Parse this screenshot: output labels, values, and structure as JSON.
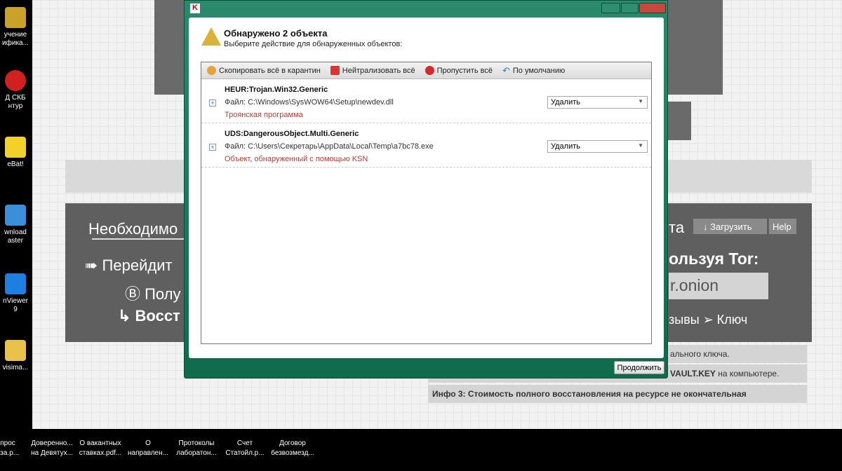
{
  "desktop": {
    "icons": [
      "учение\nифика...",
      "Д СКБ\nнтур",
      "eBat!",
      "wnload\naster",
      "nViewer\n9",
      "visima...",
      "прос\nаза.р..."
    ]
  },
  "taskbar": {
    "items": [
      "Доверенно...\nна Девятух...",
      "О вакантных\nставках.pdf...",
      "О\nнаправлен...",
      "Протоколы\nлаборатон...",
      "Счет\nСтатойл.р...",
      "Договор\nбезвозмезд..."
    ]
  },
  "web": {
    "line1": "Необходимо",
    "line1_right": "та",
    "download": "↓ Загрузить",
    "help": "Help",
    "line2": "➠ Перейдит",
    "line2_right": "ользуя Tor:",
    "line3": "Ⓑ Полу",
    "onion": "r.onion",
    "line4": "↳ Восст",
    "line4_right": "зывы  ➢  Ключ",
    "info1": "ального ключа.",
    "info2_bold": "VAULT.KEY",
    "info2": " на компьютере.",
    "info3": "Инфо 3: Стоимость полного восстановления на ресурсе не окончательная"
  },
  "dialog": {
    "title": "Обнаружено 2 объекта",
    "subtitle": "Выберите действие для обнаруженных объектов:",
    "toolbar": [
      "Скопировать всё в карантин",
      "Нейтрализовать всё",
      "Пропустить всё",
      "По умолчанию"
    ],
    "threats": [
      {
        "name": "HEUR:Trojan.Win32.Generic",
        "file": "Файл: C:\\Windows\\SysWOW64\\Setup\\newdev.dll",
        "desc": "Троянская программа",
        "action": "Удалить"
      },
      {
        "name": "UDS:DangerousObject.Multi.Generic",
        "file": "Файл: C:\\Users\\Секретарь\\AppData\\Local\\Temp\\a7bc78.exe",
        "desc": "Объект, обнаруженный с помощью KSN",
        "action": "Удалить"
      }
    ],
    "continue": "Продолжить"
  }
}
